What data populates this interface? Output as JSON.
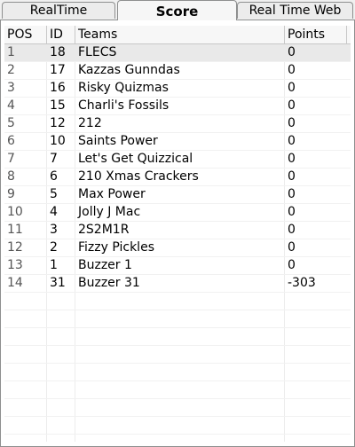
{
  "tabs": [
    "RealTime",
    "Score",
    "Real Time Web"
  ],
  "active_tab": "Score",
  "columns": [
    "POS",
    "ID",
    "Teams",
    "Points"
  ],
  "rows": [
    {
      "pos": "1",
      "id": "18",
      "team": "FLECS",
      "points": "0"
    },
    {
      "pos": "2",
      "id": "17",
      "team": "Kazzas Gunndas",
      "points": "0"
    },
    {
      "pos": "3",
      "id": "16",
      "team": "Risky Quizmas",
      "points": "0"
    },
    {
      "pos": "4",
      "id": "15",
      "team": "Charli's Fossils",
      "points": "0"
    },
    {
      "pos": "5",
      "id": "12",
      "team": "212",
      "points": "0"
    },
    {
      "pos": "6",
      "id": "10",
      "team": "Saints Power",
      "points": "0"
    },
    {
      "pos": "7",
      "id": "7",
      "team": "Let's Get Quizzical",
      "points": "0"
    },
    {
      "pos": "8",
      "id": "6",
      "team": "210 Xmas Crackers",
      "points": "0"
    },
    {
      "pos": "9",
      "id": "5",
      "team": "Max Power",
      "points": "0"
    },
    {
      "pos": "10",
      "id": "4",
      "team": "Jolly J Mac",
      "points": "0"
    },
    {
      "pos": "11",
      "id": "3",
      "team": "2S2M1R",
      "points": "0"
    },
    {
      "pos": "12",
      "id": "2",
      "team": "Fizzy Pickles",
      "points": "0"
    },
    {
      "pos": "13",
      "id": "1",
      "team": "Buzzer 1",
      "points": "0"
    },
    {
      "pos": "14",
      "id": "31",
      "team": "Buzzer 31",
      "points": "-303"
    }
  ],
  "selected_row": 0
}
